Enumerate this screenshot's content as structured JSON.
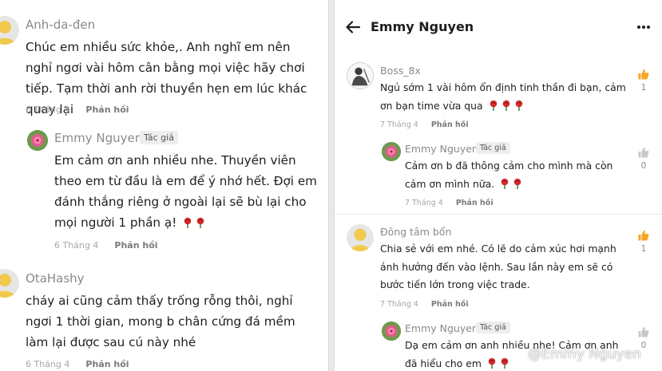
{
  "left": {
    "comments": [
      {
        "user": "Anh-da-đen",
        "text": "Chúc em nhiều sức khỏe,. Anh nghĩ em nên nghỉ ngơi vài hôm cân bằng mọi việc hãy chơi tiếp. Tạm thời anh rời thuyền hẹn em lúc khác quay lại",
        "date": "6 Tháng 4",
        "reply_label": "Phản hồi"
      },
      {
        "user": "Emmy Nguyen",
        "badge": "Tác giả",
        "text": "Em cảm ơn anh nhiều nhe. Thuyền viên theo em từ đầu là em để ý nhớ hết. Đợi em đánh thắng riêng ở ngoài lại sẽ bù lại cho mọi người 1 phần ạ!",
        "date": "6 Tháng 4",
        "reply_label": "Phản hồi"
      },
      {
        "user": "OtaHashy",
        "text": "cháy ai cũng cảm thấy trống rỗng thôi, nghỉ ngơi 1 thời gian, mong b chân cứng đá mềm làm lại được sau cú này nhé",
        "date": "6 Tháng 4",
        "reply_label": "Phản hồi"
      }
    ]
  },
  "right": {
    "title": "Emmy Nguyen",
    "comments": [
      {
        "user": "Boss_8x",
        "text": "Ngủ sớm 1 vài hôm ổn định tinh thần đi bạn, cảm ơn bạn time vừa qua",
        "date": "7 Tháng 4",
        "reply_label": "Phản hồi",
        "likes": "1"
      },
      {
        "user": "Emmy Nguyen",
        "badge": "Tác giả",
        "text": "Cảm ơn b đã thông cảm cho mình mà còn cảm ơn mình nữa.",
        "date": "7 Tháng 4",
        "reply_label": "Phản hồi",
        "likes": "0"
      },
      {
        "user": "Đông tâm bổn",
        "text": "Chia sẻ với em nhé. Có lẽ do cảm xúc hơi mạnh ảnh hưởng đến vào lệnh. Sau lần này em sẽ có bước tiến lớn trong việc trade.",
        "date": "7 Tháng 4",
        "reply_label": "Phản hồi",
        "likes": "1"
      },
      {
        "user": "Emmy Nguyen",
        "badge": "Tác giả",
        "text": "Dạ em cảm ơn anh nhiều nhe! Cảm ơn anh đã hiểu cho em",
        "likes": "0"
      }
    ]
  },
  "watermark": {
    "text": "@Emmy Nguyen"
  },
  "colors": {
    "accent_like": "#f5a623",
    "rose": "#d42a2a"
  }
}
